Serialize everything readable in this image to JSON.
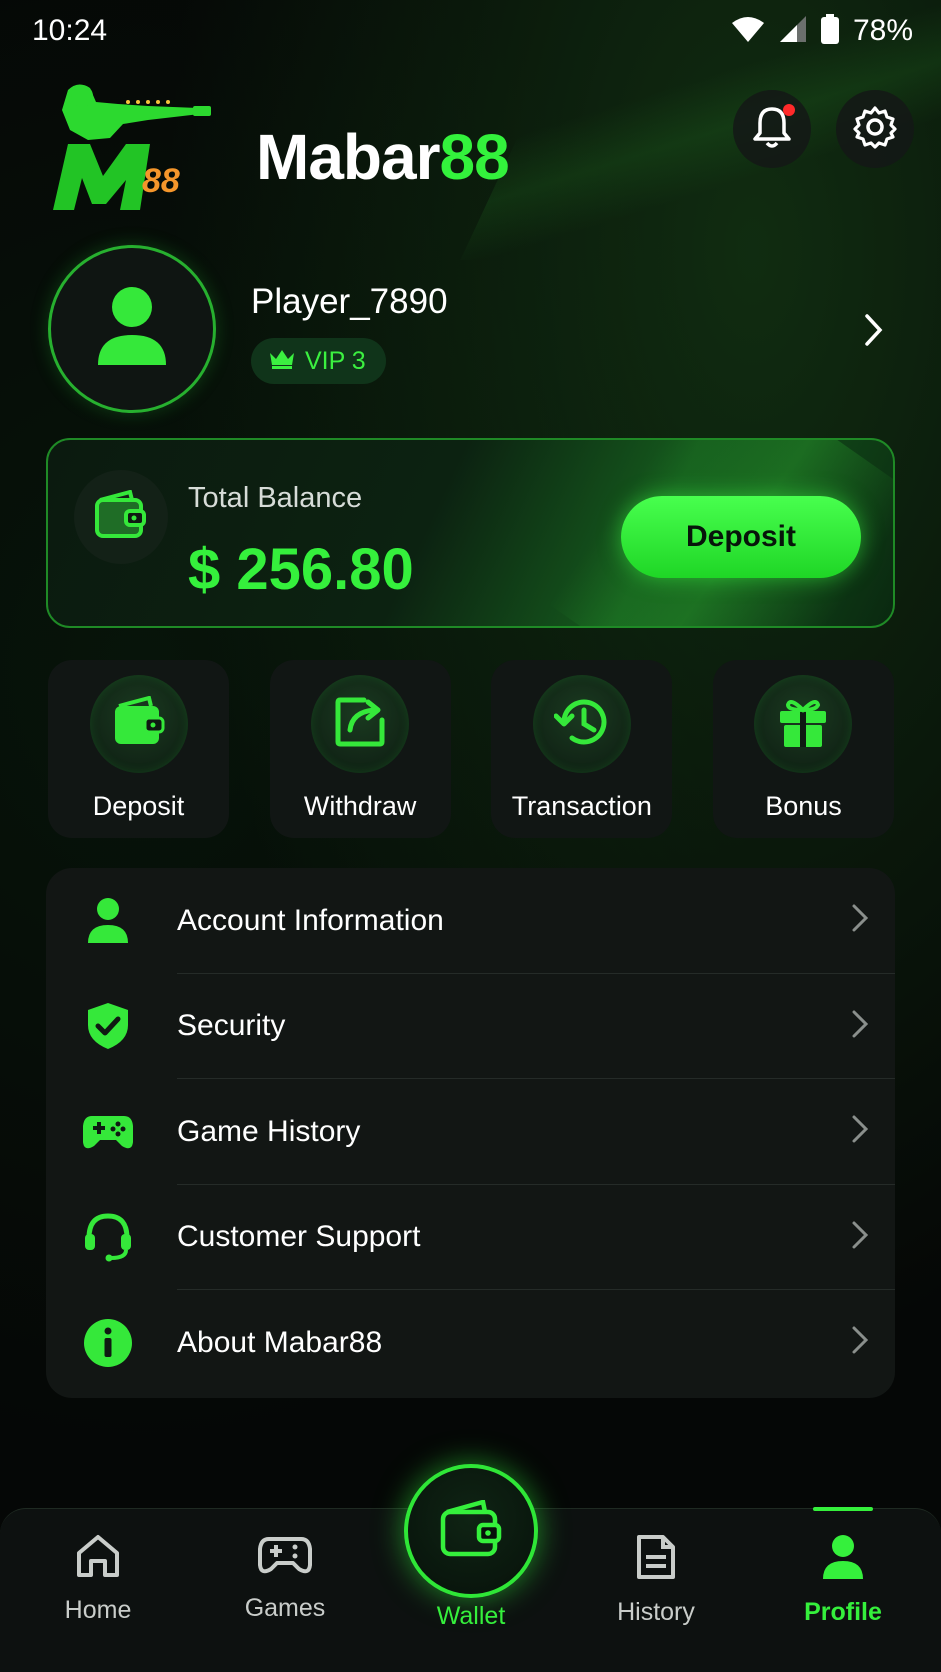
{
  "status_bar": {
    "time": "10:24",
    "battery": "78%"
  },
  "header": {
    "brand_part1": "Mabar",
    "brand_part2": "88",
    "logo_text": "M88"
  },
  "profile": {
    "username": "Player_7890",
    "vip_label": "VIP 3"
  },
  "balance": {
    "label": "Total Balance",
    "amount": "$ 256.80",
    "deposit_label": "Deposit"
  },
  "quick_actions": [
    {
      "label": "Deposit",
      "icon": "wallet-icon"
    },
    {
      "label": "Withdraw",
      "icon": "withdraw-icon"
    },
    {
      "label": "Transaction",
      "icon": "history-clock-icon"
    },
    {
      "label": "Bonus",
      "icon": "gift-icon"
    }
  ],
  "menu": [
    {
      "label": "Account Information",
      "icon": "user-icon"
    },
    {
      "label": "Security",
      "icon": "shield-check-icon"
    },
    {
      "label": "Game History",
      "icon": "gamepad-icon"
    },
    {
      "label": "Customer Support",
      "icon": "headset-icon"
    },
    {
      "label": "About Mabar88",
      "icon": "info-icon"
    }
  ],
  "bottom_nav": {
    "home": "Home",
    "games": "Games",
    "wallet": "Wallet",
    "history": "History",
    "profile": "Profile",
    "active": "profile"
  },
  "colors": {
    "accent": "#35f03c",
    "background": "#050706",
    "card": "#121614",
    "notification_dot": "#ff2a2a"
  }
}
